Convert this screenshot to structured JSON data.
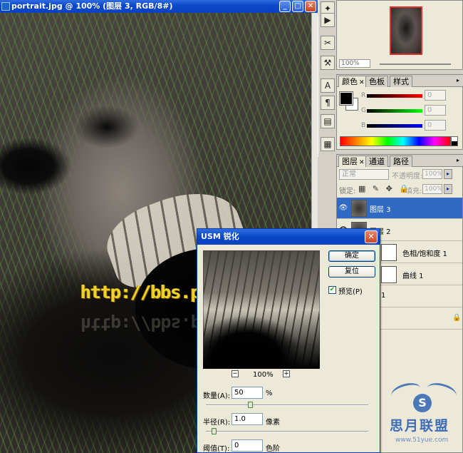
{
  "document": {
    "title": "portrait.jpg @ 100% (图层 3, RGB/8#)",
    "watermark": "http://bbs.psfeng.cn/"
  },
  "tools": [
    "tool-move",
    "tool-play",
    "tool-scissors",
    "tool-stamp",
    "tool-text",
    "tool-paragraph",
    "tool-notes"
  ],
  "navigator": {
    "zoom": "100%"
  },
  "color_panel": {
    "tabs": [
      {
        "label": "颜色",
        "active": true,
        "closable": true
      },
      {
        "label": "色板",
        "active": false,
        "closable": false
      },
      {
        "label": "样式",
        "active": false,
        "closable": false
      }
    ],
    "channels": [
      {
        "label": "R",
        "value": "0",
        "color": "#c00000"
      },
      {
        "label": "G",
        "value": "0",
        "color": "#00a000"
      },
      {
        "label": "B",
        "value": "0",
        "color": "#0000c0"
      }
    ]
  },
  "layers_panel": {
    "tabs": [
      {
        "label": "图层",
        "active": true,
        "closable": true
      },
      {
        "label": "通道",
        "active": false,
        "closable": false
      },
      {
        "label": "路径",
        "active": false,
        "closable": false
      }
    ],
    "blend_mode": "正常",
    "opacity_label": "不透明度:",
    "opacity_value": "100%",
    "lock_label": "锁定:",
    "lock_icons": "▦ ✎ ✥ 🔒",
    "fill_label": "填充:",
    "fill_value": "100%",
    "layers": [
      {
        "name": "图层 3",
        "selected": true
      },
      {
        "name": "图层 2",
        "selected": false
      },
      {
        "name": "色相/饱和度 1",
        "selected": false
      },
      {
        "name": "曲线 1",
        "selected": false
      },
      {
        "name": "1",
        "selected": false
      },
      {
        "name": "",
        "selected": false
      }
    ]
  },
  "usm_dialog": {
    "title": "USM 锐化",
    "ok_label": "确定",
    "reset_label": "复位",
    "preview_label": "预览(P)",
    "preview_checked": true,
    "zoom_level": "100%",
    "amount_label": "数量(A):",
    "amount_value": "50",
    "amount_unit": "%",
    "radius_label": "半径(R):",
    "radius_value": "1.0",
    "radius_unit": "像素",
    "threshold_label": "阈值(T):",
    "threshold_value": "0",
    "threshold_unit": "色阶"
  },
  "site_logo": {
    "text": "思月联盟",
    "url": "www.51yue.com"
  }
}
